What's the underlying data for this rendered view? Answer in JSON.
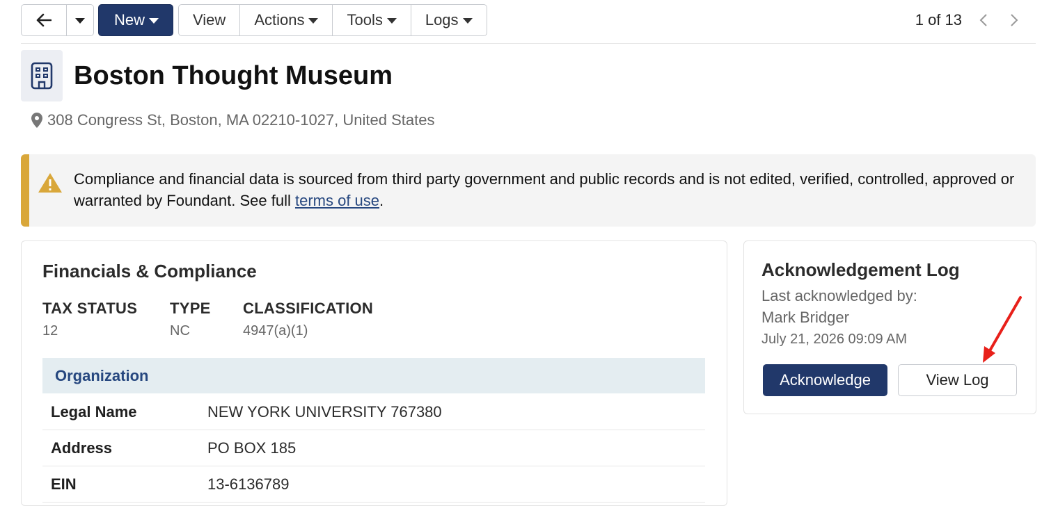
{
  "toolbar": {
    "back_icon": "arrow-left-icon",
    "new_label": "New",
    "view_label": "View",
    "actions_label": "Actions",
    "tools_label": "Tools",
    "logs_label": "Logs"
  },
  "pager": {
    "text": "1 of 13"
  },
  "header": {
    "icon": "building-icon",
    "title": "Boston Thought Museum",
    "address": "308 Congress St, Boston, MA 02210-1027, United States"
  },
  "alert": {
    "text_before": "Compliance and financial data is sourced from third party government and public records and is not edited, verified, controlled, approved or warranted by Foundant. See full ",
    "link": "terms of use",
    "text_after": ".",
    "accent_color": "#d9a73a"
  },
  "financials": {
    "title": "Financials & Compliance",
    "tax_status_label": "TAX STATUS",
    "tax_status_value": "12",
    "type_label": "TYPE",
    "type_value": "NC",
    "classification_label": "CLASSIFICATION",
    "classification_value": "4947(a)(1)",
    "section_title": "Organization",
    "rows": [
      {
        "label": "Legal Name",
        "value": "NEW YORK UNIVERSITY 767380"
      },
      {
        "label": "Address",
        "value": "PO BOX 185"
      },
      {
        "label": "EIN",
        "value": "13-6136789"
      }
    ]
  },
  "ack_log": {
    "title": "Acknowledgement Log",
    "last_label": "Last acknowledged by:",
    "name": "Mark Bridger",
    "date": "July 21, 2026 09:09 AM",
    "ack_button": "Acknowledge",
    "view_button": "View Log"
  },
  "colors": {
    "primary": "#21386a",
    "link": "#26477f",
    "annotation_arrow": "#e8201a"
  }
}
